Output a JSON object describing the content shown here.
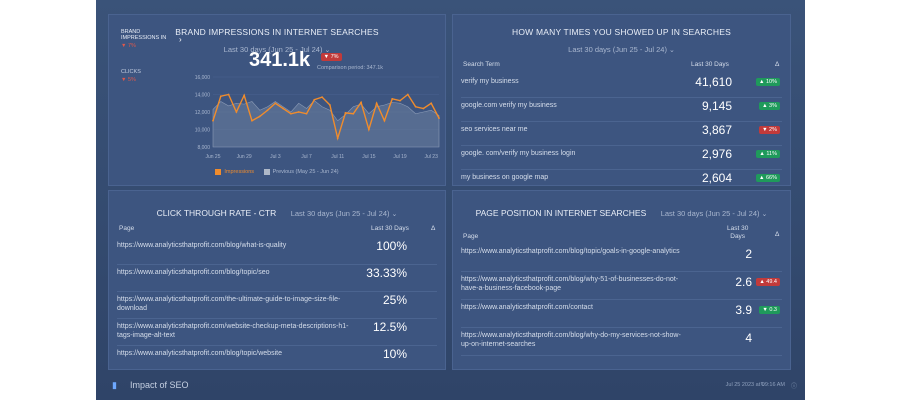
{
  "colors": {
    "accent": "#f08c2c",
    "up": "#1f9a5b",
    "down": "#c23a3a",
    "panel": "#3d5580"
  },
  "brand": {
    "title": "BRAND IMPRESSIONS IN INTERNET SEARCHES",
    "date_range": "Last 30 days (Jun 25 - Jul 24)",
    "side_metric_1": "BRAND IMPRESSIONS IN",
    "side_metric_1_delta": "▼ 7%",
    "side_metric_2": "CLICKS",
    "side_metric_2_delta": "▼ 5%",
    "big_value": "341.1k",
    "delta": "▼ 7%",
    "comparison": "Comparison period: 347.1k",
    "legend_current": "Impressions",
    "legend_previous": "Previous (May 25 - Jun 24)"
  },
  "chart_data": {
    "type": "line",
    "x": [
      "Jun 25",
      "Jun 26",
      "Jun 27",
      "Jun 28",
      "Jun 29",
      "Jun 30",
      "Jul 1",
      "Jul 2",
      "Jul 3",
      "Jul 4",
      "Jul 5",
      "Jul 6",
      "Jul 7",
      "Jul 8",
      "Jul 9",
      "Jul 10",
      "Jul 11",
      "Jul 12",
      "Jul 13",
      "Jul 14",
      "Jul 15",
      "Jul 16",
      "Jul 17",
      "Jul 18",
      "Jul 19",
      "Jul 20",
      "Jul 21",
      "Jul 22",
      "Jul 23",
      "Jul 24"
    ],
    "x_ticks": [
      "Jun 25",
      "Jun 29",
      "Jul 3",
      "Jul 7",
      "Jul 11",
      "Jul 15",
      "Jul 19",
      "Jul 23"
    ],
    "series": [
      {
        "name": "Impressions",
        "values": [
          11000,
          13800,
          14000,
          12000,
          13900,
          11000,
          11500,
          12200,
          13000,
          12400,
          11800,
          12000,
          11800,
          13400,
          13700,
          12800,
          9000,
          11900,
          11800,
          13100,
          10000,
          13000,
          11000,
          13500,
          13300,
          14000,
          12600,
          12400,
          13000,
          11300
        ]
      },
      {
        "name": "Previous (May 25 - Jun 24)",
        "values": [
          12300,
          13200,
          12700,
          13000,
          12900,
          13200,
          12200,
          12600,
          13200,
          12600,
          12000,
          13000,
          12400,
          13300,
          12600,
          12200,
          11000,
          11700,
          12600,
          12900,
          11800,
          12600,
          12800,
          13100,
          13000,
          12600,
          11800,
          12000,
          12200,
          11600
        ]
      }
    ],
    "y_ticks": [
      "16,000",
      "14,000",
      "12,000",
      "10,000",
      "8,000"
    ],
    "ylim": [
      8000,
      16000
    ]
  },
  "times": {
    "title": "HOW MANY TIMES YOU SHOWED UP IN SEARCHES",
    "date_range": "Last 30 days (Jun 25 - Jul 24)",
    "col_term": "Search Term",
    "col_value": "Last 30 Days",
    "col_delta": "Δ",
    "rows": [
      {
        "term": "verify my business",
        "value": "41,610",
        "delta": "▲ 10%",
        "dir": "up"
      },
      {
        "term": "google.com verify my business",
        "value": "9,145",
        "delta": "▲ 3%",
        "dir": "up"
      },
      {
        "term": "seo services near me",
        "value": "3,867",
        "delta": "▼ 2%",
        "dir": "down"
      },
      {
        "term": "google. com/verify my business login",
        "value": "2,976",
        "delta": "▲ 11%",
        "dir": "up"
      },
      {
        "term": "my business on google map",
        "value": "2,604",
        "delta": "▲ 66%",
        "dir": "up"
      }
    ]
  },
  "ctr": {
    "title": "CLICK THROUGH RATE - CTR",
    "date_range": "Last 30 days (Jun 25 - Jul 24)",
    "col_page": "Page",
    "col_value": "Last 30 Days",
    "col_delta": "Δ",
    "rows": [
      {
        "page": "https://www.analyticsthatprofit.com/blog/what-is-quality",
        "value": "100%"
      },
      {
        "page": "https://www.analyticsthatprofit.com/blog/topic/seo",
        "value": "33.33%"
      },
      {
        "page": "https://www.analyticsthatprofit.com/the-ultimate-guide-to-image-size-file-download",
        "value": "25%"
      },
      {
        "page": "https://www.analyticsthatprofit.com/website-checkup-meta-descriptions-h1-tags-image-alt-text",
        "value": "12.5%"
      },
      {
        "page": "https://www.analyticsthatprofit.com/blog/topic/website",
        "value": "10%"
      }
    ]
  },
  "position": {
    "title": "PAGE POSITION IN INTERNET SEARCHES",
    "date_range": "Last 30 days (Jun 25 - Jul 24)",
    "col_page": "Page",
    "col_value_1": "Last 30",
    "col_value_2": "Days",
    "col_delta": "Δ",
    "rows": [
      {
        "page": "https://www.analyticsthatprofit.com/blog/topic/goals-in-google-analytics",
        "value": "2",
        "delta": "",
        "dir": ""
      },
      {
        "page": "https://www.analyticsthatprofit.com/blog/why-51-of-businesses-do-not-have-a-business-facebook-page",
        "value": "2.6",
        "delta": "▲ 49.4",
        "dir": "down"
      },
      {
        "page": "https://www.analyticsthatprofit.com/contact",
        "value": "3.9",
        "delta": "▼ 0.3",
        "dir": "up"
      },
      {
        "page": "https://www.analyticsthatprofit.com/blog/why-do-my-services-not-show-up-on-internet-searches",
        "value": "4",
        "delta": "",
        "dir": ""
      }
    ]
  },
  "footer": {
    "title": "Impact of SEO",
    "timestamp": "Jul 25 2023 at 09:16 AM"
  }
}
